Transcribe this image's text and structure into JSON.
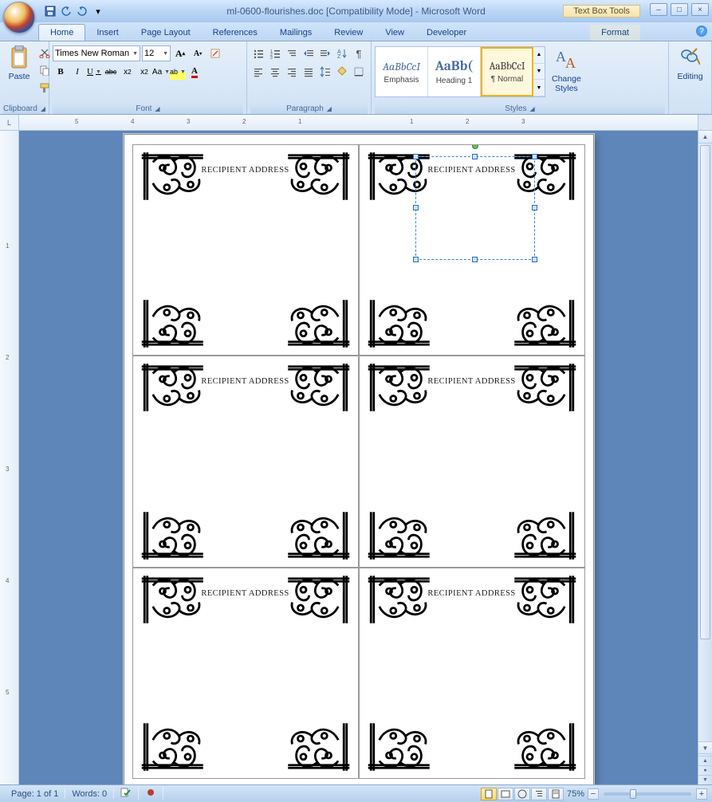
{
  "title": "ml-0600-flourishes.doc [Compatibility Mode] - Microsoft Word",
  "contextual_tab_group": "Text Box Tools",
  "win": {
    "minimize": "–",
    "restore": "□",
    "close": "×"
  },
  "qat": {
    "save": "save-icon",
    "undo": "undo-icon",
    "redo": "redo-icon",
    "more": "▾"
  },
  "tabs": [
    "Home",
    "Insert",
    "Page Layout",
    "References",
    "Mailings",
    "Review",
    "View",
    "Developer"
  ],
  "active_tab_index": 0,
  "contextual_tab": "Format",
  "ribbon": {
    "clipboard": {
      "label": "Clipboard",
      "paste": "Paste"
    },
    "font": {
      "label": "Font",
      "font_name": "Times New Roman",
      "font_size": "12",
      "grow": "A",
      "shrink": "A",
      "clearfmt": "¶",
      "bold": "B",
      "italic": "I",
      "underline": "U",
      "strike": "abc",
      "sub": "x₂",
      "sup": "x²",
      "case": "Aa",
      "highlight": "ab",
      "fontcolor": "A"
    },
    "paragraph": {
      "label": "Paragraph"
    },
    "styles": {
      "label": "Styles",
      "items": [
        {
          "preview": "AaBbCcI",
          "name": "Emphasis"
        },
        {
          "preview": "AaBb(",
          "name": "Heading 1"
        },
        {
          "preview": "AaBbCcI",
          "name": "¶ Normal"
        }
      ],
      "selected_index": 2,
      "change_styles": "Change\nStyles"
    },
    "editing": {
      "label": "Editing",
      "find": "Editing"
    }
  },
  "ruler": {
    "corner": "L",
    "hnums": [
      "5",
      "4",
      "3",
      "2",
      "1",
      "",
      "1",
      "2",
      "3"
    ],
    "vnums": [
      "",
      "1",
      "2",
      "3",
      "4",
      "5"
    ]
  },
  "labels": {
    "default_text": "RECIPIENT ADDRESS",
    "cells": [
      "RECIPIENT ADDRESS",
      "RECIPIENT ADDRESS",
      "RECIPIENT ADDRESS",
      "RECIPIENT ADDRESS",
      "RECIPIENT ADDRESS",
      "RECIPIENT ADDRESS"
    ],
    "selected_cell_index": 1
  },
  "statusbar": {
    "page": "Page: 1 of 1",
    "words": "Words: 0",
    "lang_icon": "EN",
    "zoom": "75%",
    "zoom_minus": "−",
    "zoom_plus": "+"
  },
  "colors": {
    "accent": "#15428b",
    "selection": "#3a83d0"
  }
}
